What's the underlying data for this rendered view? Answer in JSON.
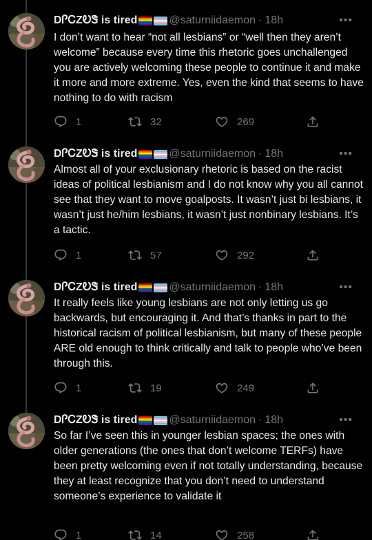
{
  "author": {
    "display_name": "DᎵᏟZᎧᏕ is tired",
    "handle": "@saturniidaemon",
    "separator": "·"
  },
  "icons": {
    "more": "more-icon",
    "reply": "reply-icon",
    "retweet": "retweet-icon",
    "like": "heart-icon",
    "share": "share-icon"
  },
  "colors": {
    "background": "#000000",
    "text": "#e7e9ea",
    "secondary": "#71767b"
  },
  "more_label": "•••",
  "tweets": [
    {
      "time": "18h",
      "text": "I don’t want to hear “not all lesbians” or “well then they aren’t welcome” because every time this rhetoric goes unchallenged you are actively welcoming these people to continue it and make it more and more extreme. Yes, even the kind that seems to have nothing to do with racism",
      "replies": "1",
      "retweets": "32",
      "likes": "269"
    },
    {
      "time": "18h",
      "text": "Almost all of your exclusionary rhetoric is based on the racist ideas of political lesbianism and I do not know why you all cannot see that they want to move goalposts. It wasn’t just bi lesbians, it wasn’t just he/him lesbians, it wasn’t just nonbinary lesbians. It’s a tactic.",
      "replies": "1",
      "retweets": "57",
      "likes": "292"
    },
    {
      "time": "18h",
      "text": "It really feels like young lesbians are not only letting us go backwards, but encouraging it. And that’s thanks in part to the historical racism of political lesbianism, but many of these people ARE old enough to think critically and talk to people who’ve been through this.",
      "replies": "1",
      "retweets": "19",
      "likes": "249"
    },
    {
      "time": "18h",
      "text": "So far I’ve seen this in younger lesbian spaces; the ones with older generations (the ones that don’t welcome TERFs) have been pretty welcoming even if not totally understanding, because they at least recognize that you don’t need to understand someone’s experience to validate it",
      "replies": "1",
      "retweets": "14",
      "likes": "258"
    }
  ]
}
